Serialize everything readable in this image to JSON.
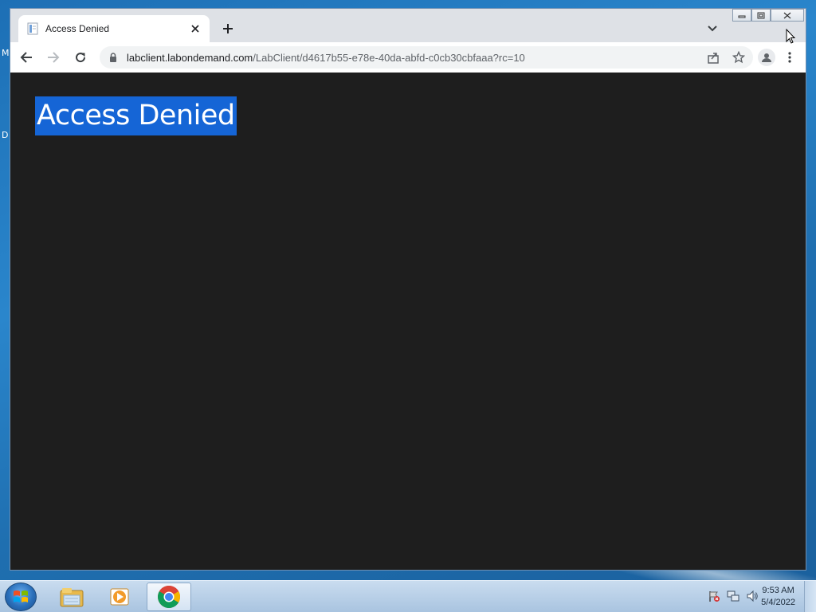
{
  "desktop": {
    "edge_letters": [
      "M",
      "D"
    ]
  },
  "browser": {
    "tab": {
      "title": "Access Denied",
      "favicon": "document-icon"
    },
    "address": {
      "host": "labclient.labondemand.com",
      "path": "/LabClient/d4617b55-e78e-40da-abfd-c0cb30cbfaaa?rc=10"
    }
  },
  "page": {
    "heading": "Access Denied",
    "background": "#1e1e1e",
    "selection_color": "#1565d6"
  },
  "taskbar": {
    "pinned": [
      "explorer-icon",
      "media-player-icon",
      "chrome-icon"
    ],
    "active": "chrome-icon",
    "clock": {
      "time": "9:53 AM",
      "date": "5/4/2022"
    }
  }
}
